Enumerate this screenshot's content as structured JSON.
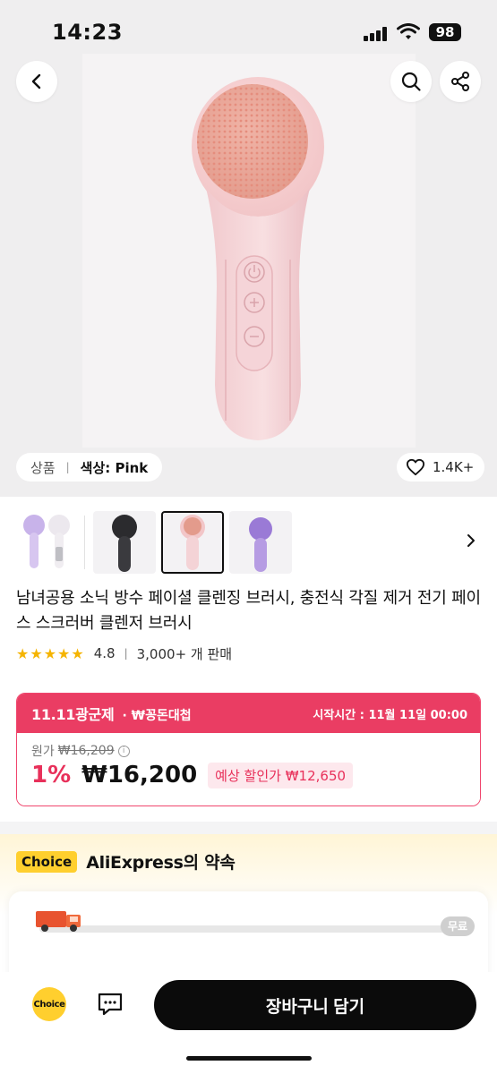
{
  "status_bar": {
    "time": "14:23",
    "battery": "98"
  },
  "hero": {
    "back_icon": "chevron-left-icon",
    "search_icon": "search-icon",
    "share_icon": "share-icon"
  },
  "variant": {
    "prefix": "상품",
    "label": "색상: Pink"
  },
  "favorites": {
    "count": "1.4K+",
    "icon": "heart-outline-icon"
  },
  "thumbnails": [
    {
      "name": "purple-white-variant"
    },
    {
      "name": "black-variant"
    },
    {
      "name": "pink-variant",
      "selected": true
    },
    {
      "name": "purple-variant"
    }
  ],
  "product": {
    "title": "남녀공용 소닉 방수 페이셜 클렌징 브러시, 충전식 각질 제거 전기 페이스 스크러버 클렌저 브러시",
    "rating": "4.8",
    "sold": "3,000+ 개 판매"
  },
  "promo": {
    "brand": "11.11광군제",
    "sub": "· ₩꽁돈대첩",
    "start": "시작시간 : 11월 11일 00:00",
    "original_label": "원가",
    "original_price": "₩16,209",
    "discount": "1%",
    "price": "₩16,200",
    "coupon": "예상 할인가 ₩12,650",
    "color": "#ea3d63"
  },
  "choice": {
    "badge": "Choice",
    "title": "AliExpress의 약속",
    "free_label": "무료",
    "shipping_progress": 0.0
  },
  "bottom": {
    "choice_label": "Choice",
    "cart_label": "장바구니 담기"
  }
}
